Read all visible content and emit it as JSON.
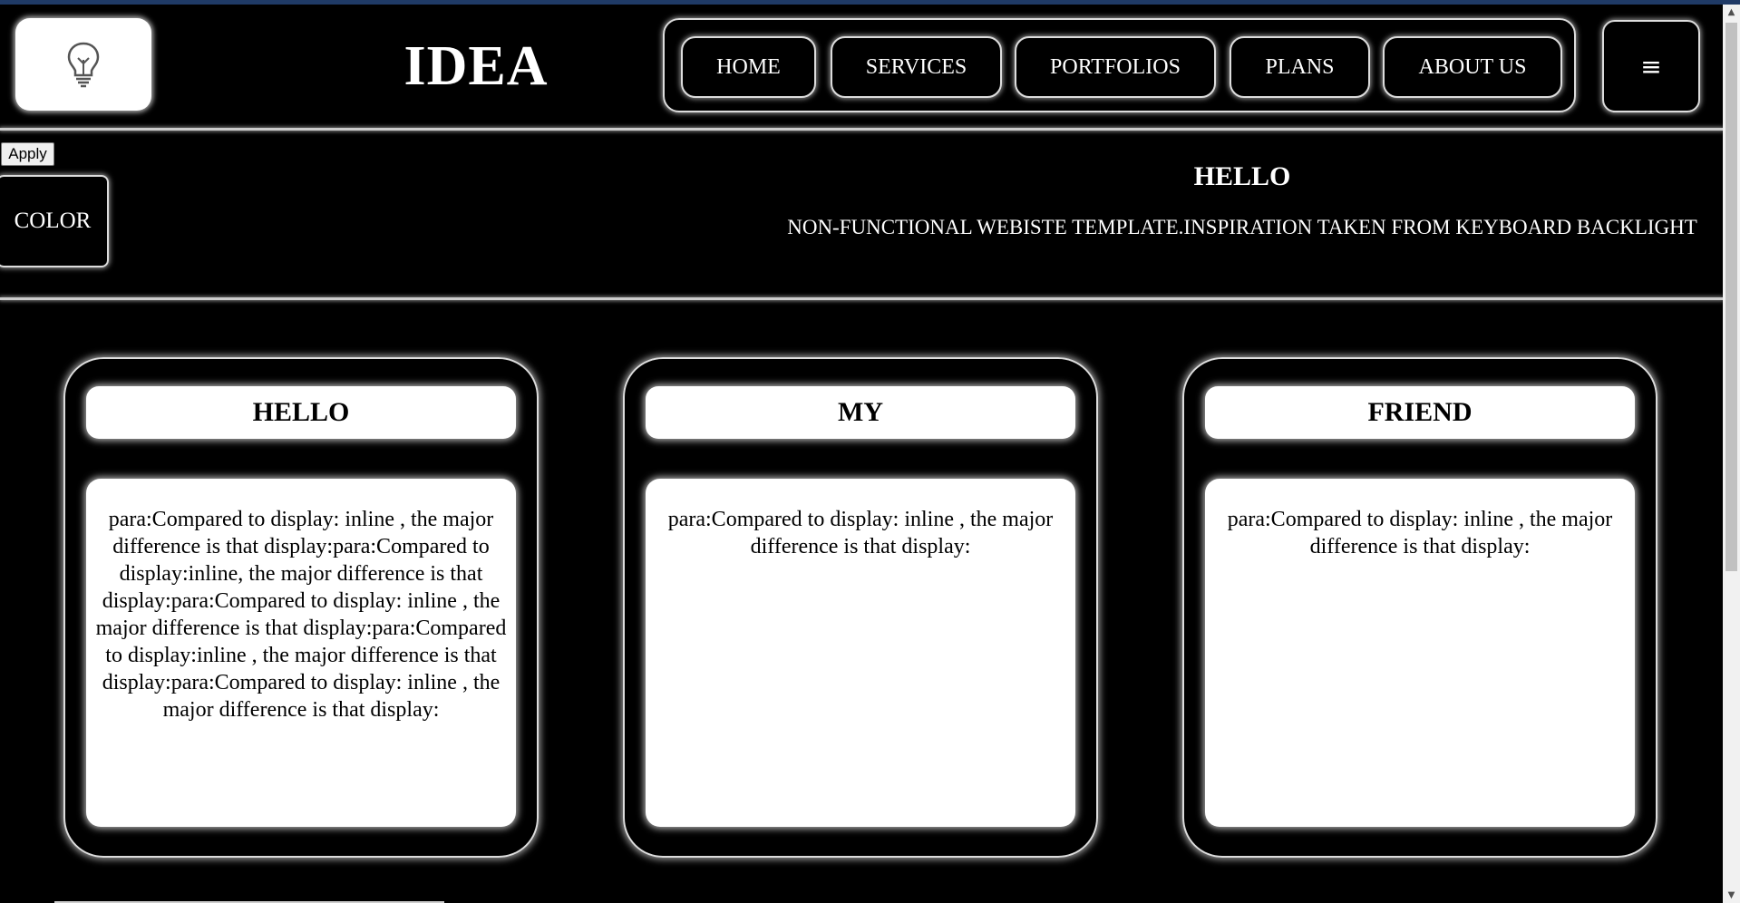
{
  "header": {
    "brand": "IDEA",
    "logo_icon": "lightbulb-icon",
    "nav": [
      "HOME",
      "SERVICES",
      "PORTFOLIOS",
      "PLANS",
      "ABOUT US"
    ],
    "menu_icon": "≡"
  },
  "controls": {
    "apply_label": "Apply",
    "color_label": "COLOR"
  },
  "hero": {
    "title": "HELLO",
    "subtitle": "NON-FUNCTIONAL WEBISTE TEMPLATE.INSPIRATION TAKEN FROM KEYBOARD BACKLIGHT"
  },
  "cards": [
    {
      "title": "HELLO",
      "body": "para:Compared to display: inline , the major difference is that display:para:Compared to display:inline, the major difference is that display:para:Compared to display: inline , the major difference is that display:para:Compared to display:inline , the major difference is that display:para:Compared to display: inline , the major difference is that display:"
    },
    {
      "title": "MY",
      "body": "para:Compared to display: inline , the major difference is that display:"
    },
    {
      "title": "FRIEND",
      "body": "para:Compared to display: inline , the major difference is that display:"
    }
  ],
  "colors": {
    "background": "#000000",
    "panel": "#ffffff",
    "glow": "#dddddd",
    "topline": "#1f3a66"
  }
}
